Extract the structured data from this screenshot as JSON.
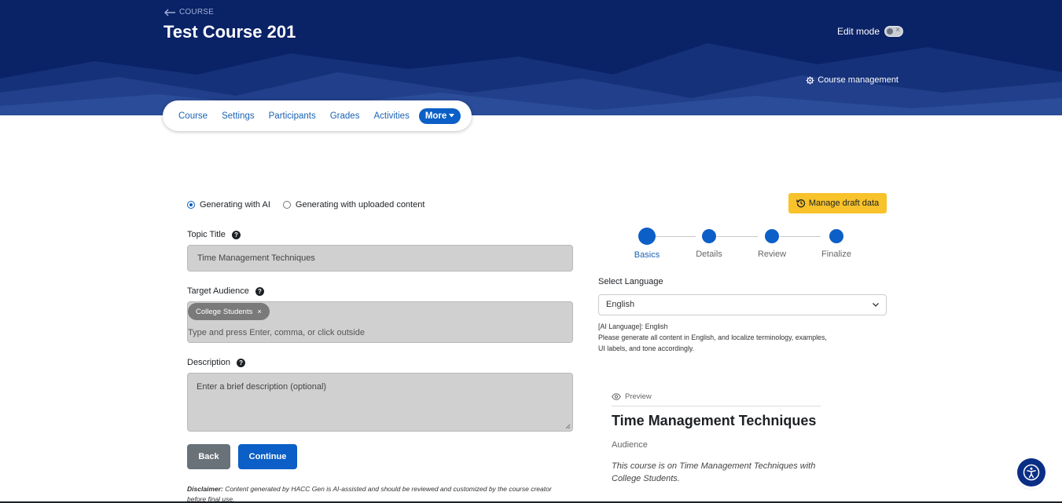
{
  "header": {
    "back_label": "COURSE",
    "course_title": "Test Course 201",
    "edit_mode_label": "Edit mode",
    "course_management_label": "Course management"
  },
  "nav": {
    "items": [
      "Course",
      "Settings",
      "Participants",
      "Grades",
      "Activities"
    ],
    "more_label": "More"
  },
  "form": {
    "mode_options": [
      {
        "label": "Generating with AI",
        "selected": true
      },
      {
        "label": "Generating with uploaded content",
        "selected": false
      }
    ],
    "topic_label": "Topic Title",
    "topic_value": "Time Management Techniques",
    "audience_label": "Target Audience",
    "audience_tags": [
      "College Students"
    ],
    "audience_placeholder": "Type and press Enter, comma, or click outside",
    "description_label": "Description",
    "description_placeholder": "Enter a brief description (optional)",
    "back_button": "Back",
    "continue_button": "Continue",
    "disclaimer_bold": "Disclaimer:",
    "disclaimer_text": " Content generated by HACC Gen is AI-assisted and should be reviewed and customized by the course creator before final use."
  },
  "side": {
    "draft_button": "Manage draft data",
    "steps": [
      {
        "label": "Basics",
        "active": true
      },
      {
        "label": "Details",
        "active": false
      },
      {
        "label": "Review",
        "active": false
      },
      {
        "label": "Finalize",
        "active": false
      }
    ],
    "language_label": "Select Language",
    "language_value": "English",
    "ai_language_line": "[AI Language]: English",
    "ai_instruction": "Please generate all content in English, and localize terminology, examples, UI labels, and tone accordingly."
  },
  "preview": {
    "header": "Preview",
    "title": "Time Management Techniques",
    "audience_label": "Audience",
    "description": "This course is on Time Management Techniques with College Students."
  },
  "colors": {
    "header_bg": "#0a2266",
    "primary": "#0b5fc6",
    "warning": "#f8c22a"
  }
}
